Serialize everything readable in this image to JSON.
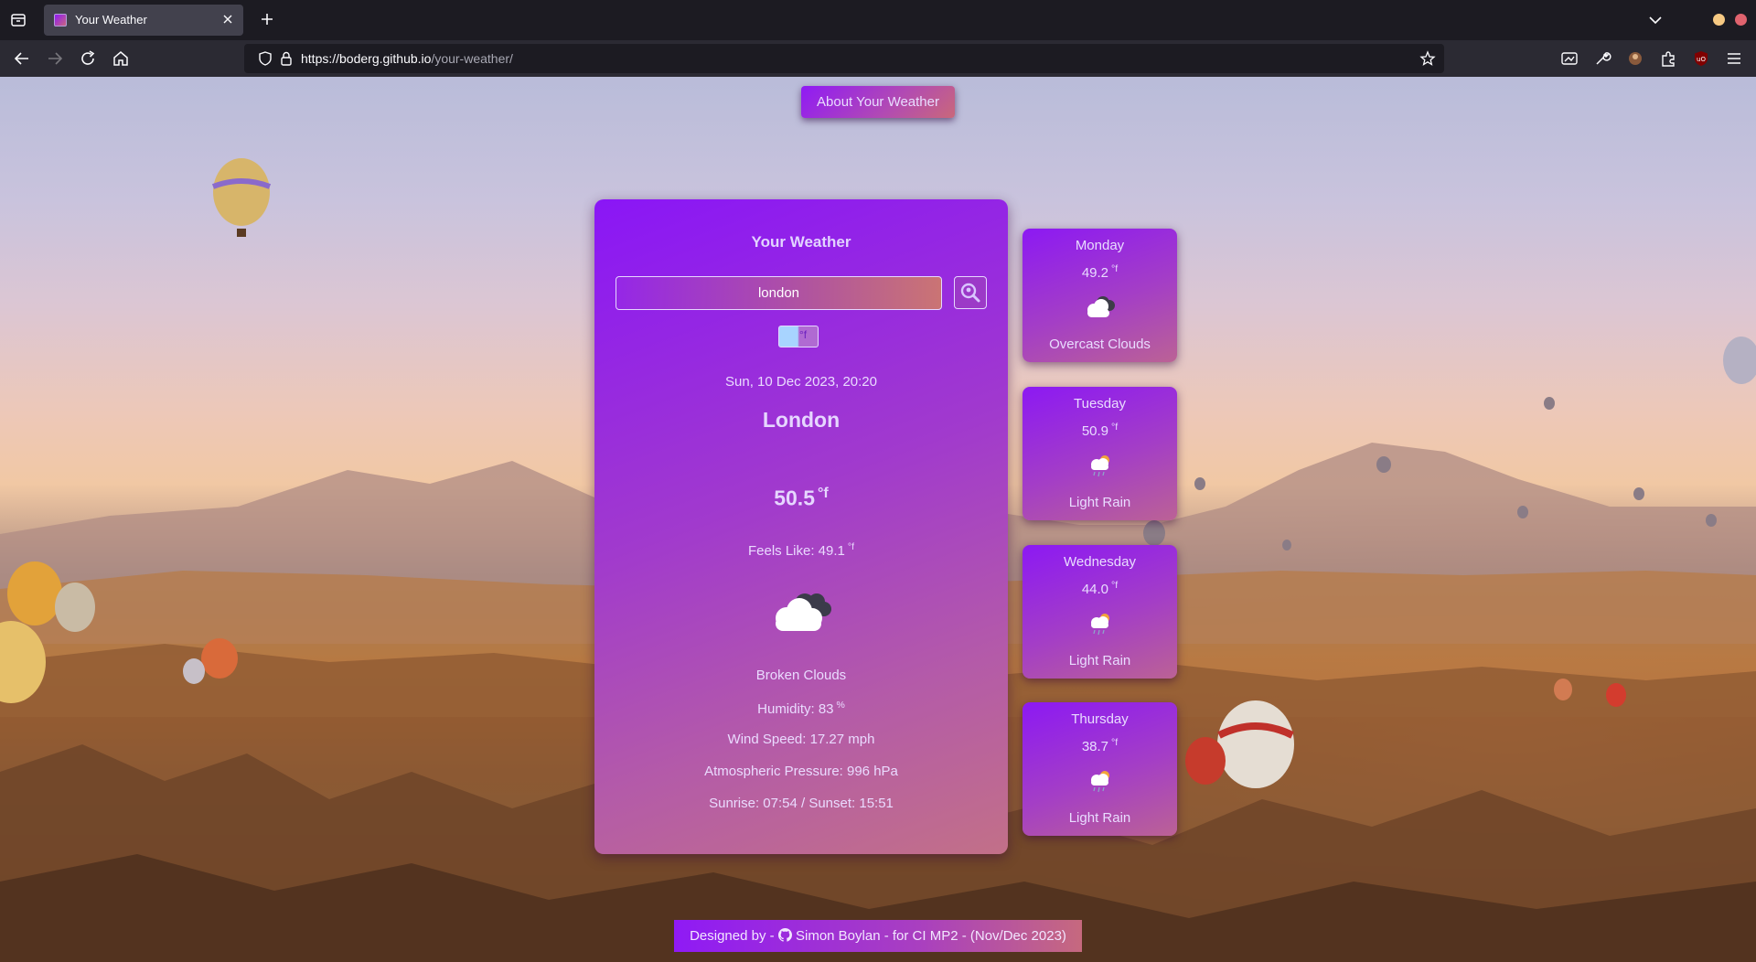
{
  "browser": {
    "tab_title": "Your Weather",
    "url_host": "https://boderg.github.io",
    "url_path": "/your-weather/"
  },
  "page": {
    "about_button": "About Your Weather",
    "card_title": "Your Weather",
    "search_value": "london",
    "unit_toggle_label": "°f",
    "datetime": "Sun, 10 Dec 2023, 20:20",
    "city": "London",
    "temperature": "50.5",
    "temp_unit": "°f",
    "feels_like": "Feels Like: 49.1",
    "description": "Broken Clouds",
    "humidity": "Humidity: 83",
    "humidity_unit": "%",
    "wind_speed": "Wind Speed: 17.27 mph",
    "pressure": "Atmospheric Pressure: 996 hPa",
    "sun_times": "Sunrise: 07:54 / Sunset: 15:51"
  },
  "forecast": [
    {
      "day": "Monday",
      "temp": "49.2",
      "unit": "°f",
      "icon": "overcast-clouds-icon",
      "desc": "Overcast Clouds"
    },
    {
      "day": "Tuesday",
      "temp": "50.9",
      "unit": "°f",
      "icon": "light-rain-icon",
      "desc": "Light Rain"
    },
    {
      "day": "Wednesday",
      "temp": "44.0",
      "unit": "°f",
      "icon": "light-rain-icon",
      "desc": "Light Rain"
    },
    {
      "day": "Thursday",
      "temp": "38.7",
      "unit": "°f",
      "icon": "light-rain-icon",
      "desc": "Light Rain"
    }
  ],
  "footer": {
    "prefix": "Designed by -",
    "suffix": "Simon Boylan - for CI MP2 - (Nov/Dec 2023)"
  },
  "colors": {
    "accent_purple": "#8f1af5",
    "accent_pink": "#c9687a",
    "browser_chrome": "#1c1b22"
  }
}
